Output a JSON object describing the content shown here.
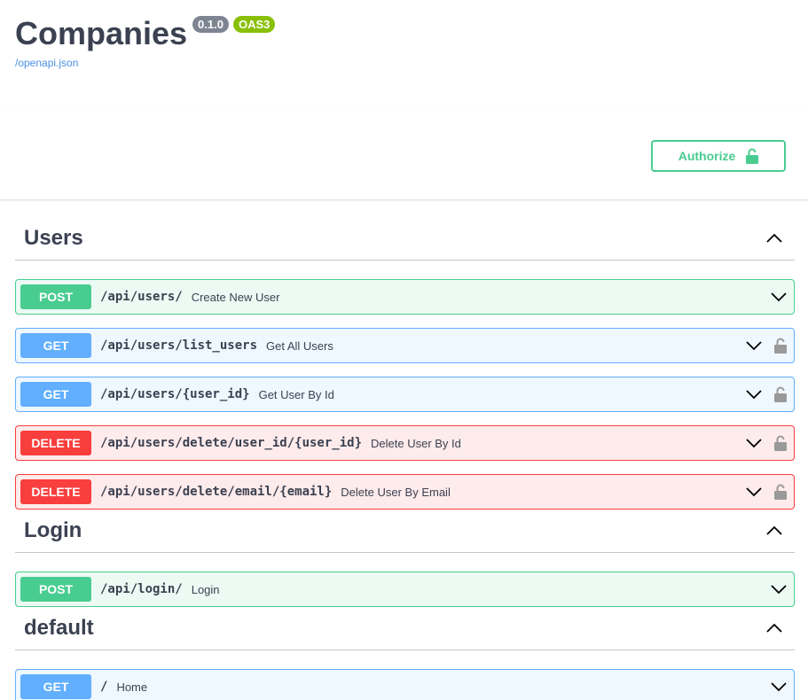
{
  "info": {
    "title": "Companies",
    "version_badge": "0.1.0",
    "oas_badge": "OAS3",
    "spec_link": "/openapi.json"
  },
  "authorize": {
    "label": "Authorize",
    "icon": "unlock-icon"
  },
  "colors": {
    "post": "#49cc90",
    "get": "#61affe",
    "delete": "#f93e3e",
    "text": "#3b4151",
    "link": "#4990e2"
  },
  "tags": [
    {
      "name": "Users",
      "operations": [
        {
          "method": "POST",
          "path": "/api/users/",
          "summary": "Create New User",
          "locked": false
        },
        {
          "method": "GET",
          "path": "/api/users/list_users",
          "summary": "Get All Users",
          "locked": true
        },
        {
          "method": "GET",
          "path": "/api/users/{user_id}",
          "summary": "Get User By Id",
          "locked": true
        },
        {
          "method": "DELETE",
          "path": "/api/users/delete/user_id/{user_id}",
          "summary": "Delete User By Id",
          "locked": true
        },
        {
          "method": "DELETE",
          "path": "/api/users/delete/email/{email}",
          "summary": "Delete User By Email",
          "locked": true
        }
      ]
    },
    {
      "name": "Login",
      "operations": [
        {
          "method": "POST",
          "path": "/api/login/",
          "summary": "Login",
          "locked": false
        }
      ]
    },
    {
      "name": "default",
      "operations": [
        {
          "method": "GET",
          "path": "/",
          "summary": "Home",
          "locked": false
        }
      ]
    }
  ]
}
